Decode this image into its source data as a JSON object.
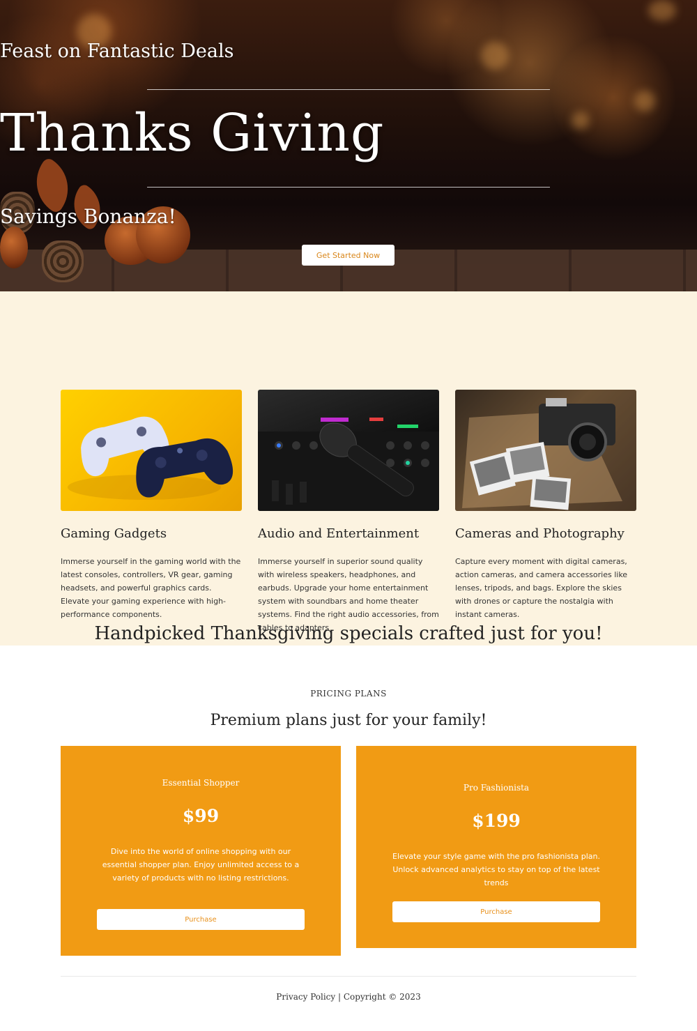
{
  "hero": {
    "subtitle": "Feast on Fantastic Deals",
    "title": "Thanks Giving",
    "tagline": "Savings Bonanza!",
    "cta_label": "Get Started Now"
  },
  "specials": {
    "heading": "Handpicked Thanksgiving specials crafted just for you!",
    "cards": [
      {
        "image_icon": "gaming-controllers-image",
        "title": "Gaming Gadgets",
        "description": "Immerse yourself in the gaming world with the latest consoles, controllers, VR gear, gaming headsets, and powerful graphics cards. Elevate your gaming experience with high-performance components."
      },
      {
        "image_icon": "audio-mixer-microphone-image",
        "title": "Audio and Entertainment",
        "description": "Immerse yourself in superior sound quality with wireless speakers, headphones, and earbuds. Upgrade your home entertainment system with soundbars and home theater systems. Find the right audio accessories, from cables to adapters"
      },
      {
        "image_icon": "vintage-camera-photos-image",
        "title": "Cameras and Photography",
        "description": "Capture every moment with digital cameras, action cameras, and camera accessories like lenses, tripods, and bags. Explore the skies with drones or capture the nostalgia with instant cameras."
      }
    ]
  },
  "pricing": {
    "eyebrow": "PRICING PLANS",
    "headline": "Premium plans just for your family!",
    "plans": [
      {
        "name": "Essential Shopper",
        "price": "$99",
        "description": "Dive into the world of online shopping with our essential shopper plan. Enjoy unlimited access to a variety of products with no listing restrictions.",
        "button_label": "Purchase"
      },
      {
        "name": "Pro Fashionista",
        "price": "$199",
        "description": "Elevate your style game with the pro fashionista plan. Unlock advanced analytics to stay on top of the latest trends",
        "button_label": "Purchase"
      }
    ]
  },
  "footer": {
    "privacy_label": "Privacy Policy",
    "separator": " | ",
    "copyright": "Copyright © 2023"
  },
  "colors": {
    "accent": "#f19b14",
    "button_text": "#d9861a",
    "section_bg": "#fcf3e0"
  }
}
